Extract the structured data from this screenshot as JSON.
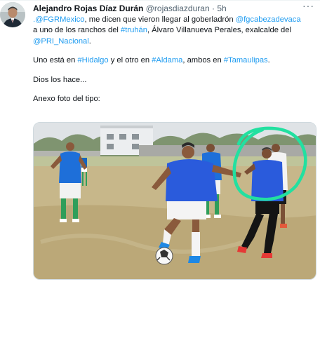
{
  "author": {
    "name": "Alejandro Rojas Díaz Durán",
    "handle": "@rojasdiazduran",
    "separator": "·",
    "time": "5h"
  },
  "more_label": "···",
  "tweet": {
    "line1_link": ".@FGRMexico",
    "line1_text": ", me dicen que vieron llegar al goberladrón ",
    "line1_link2": "@fgcabezadevaca",
    "line2_text1": "a uno de los ranchos del ",
    "line2_link": "#truhán",
    "line2_text2": ", Álvaro Villanueva Perales, exalcalde del",
    "line3_link": "@PRI_Nacional",
    "line3_text": ".",
    "p2_text1": "Uno está en ",
    "p2_link1": "#Hidalgo",
    "p2_text2": " y el otro en ",
    "p2_link2": "#Aldama",
    "p2_text3": ", ambos en ",
    "p2_link3": "#Tamaulipas",
    "p2_text4": ".",
    "p3": "Dios los hace...",
    "p4": "Anexo foto del tipo:"
  },
  "colors": {
    "link": "#1d9bf0",
    "text": "#0f1419",
    "muted": "#536471",
    "circle": "#22e0a0"
  },
  "icons": [
    "more-options-icon"
  ]
}
